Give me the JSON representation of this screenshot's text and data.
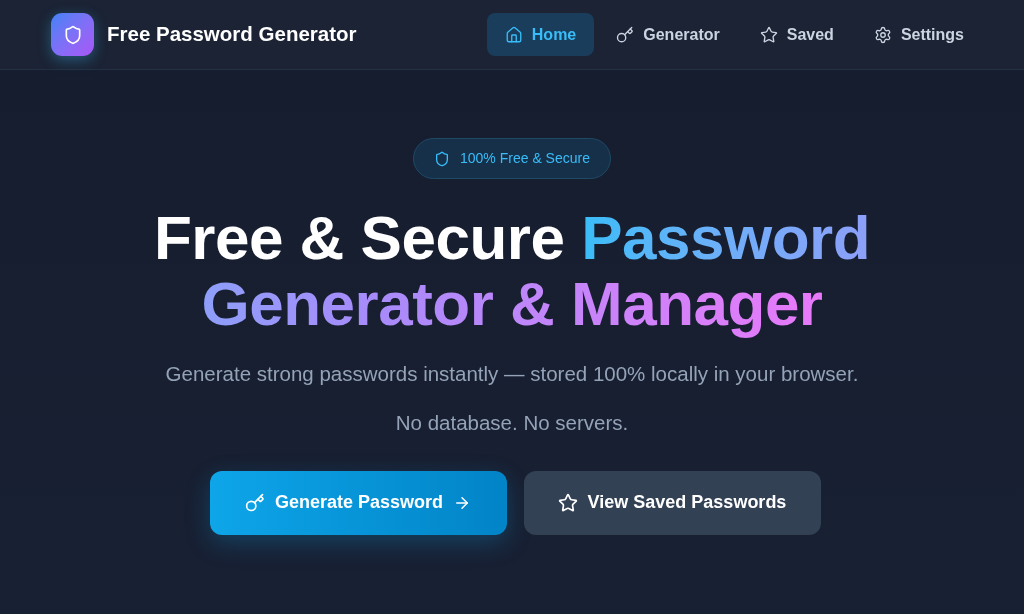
{
  "brand": {
    "name": "Free Password Generator"
  },
  "nav": [
    {
      "label": "Home",
      "selected": true
    },
    {
      "label": "Generator",
      "selected": false
    },
    {
      "label": "Saved",
      "selected": false
    },
    {
      "label": "Settings",
      "selected": false
    }
  ],
  "hero": {
    "badge": "100% Free & Secure",
    "headline": {
      "plain": "Free & Secure",
      "highlight": "Password Generator & Manager"
    },
    "subtitle": "Generate strong passwords instantly — stored 100% locally in your browser.",
    "note": "No database. No servers.",
    "buttons": [
      {
        "label": "Generate Password",
        "kind": "primary"
      },
      {
        "label": "View Saved Passwords",
        "kind": "secondary"
      }
    ]
  }
}
